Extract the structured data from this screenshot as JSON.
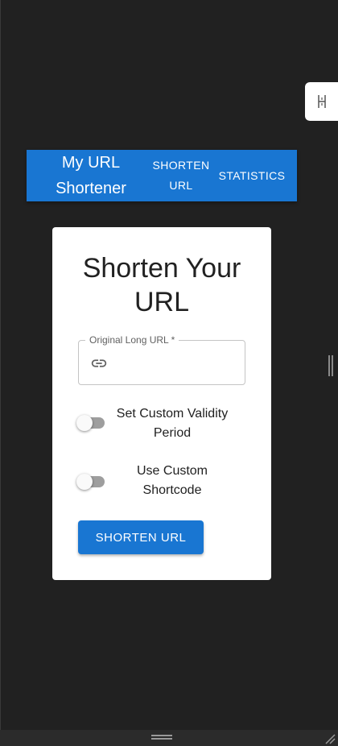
{
  "app_bar": {
    "brand": "My URL Shortener",
    "nav": [
      {
        "label": "SHORTEN URL"
      },
      {
        "label": "STATISTICS"
      }
    ],
    "color": "#1976d2"
  },
  "card": {
    "title": "Shorten Your URL",
    "url_field": {
      "label": "Original Long URL *",
      "value": "",
      "icon": "link-icon"
    },
    "toggles": [
      {
        "label": "Set Custom Validity Period",
        "checked": false
      },
      {
        "label": "Use Custom Shortcode",
        "checked": false
      }
    ],
    "submit_label": "SHORTEN URL"
  },
  "colors": {
    "background": "#212121",
    "primary": "#1976d2",
    "card": "#ffffff"
  }
}
